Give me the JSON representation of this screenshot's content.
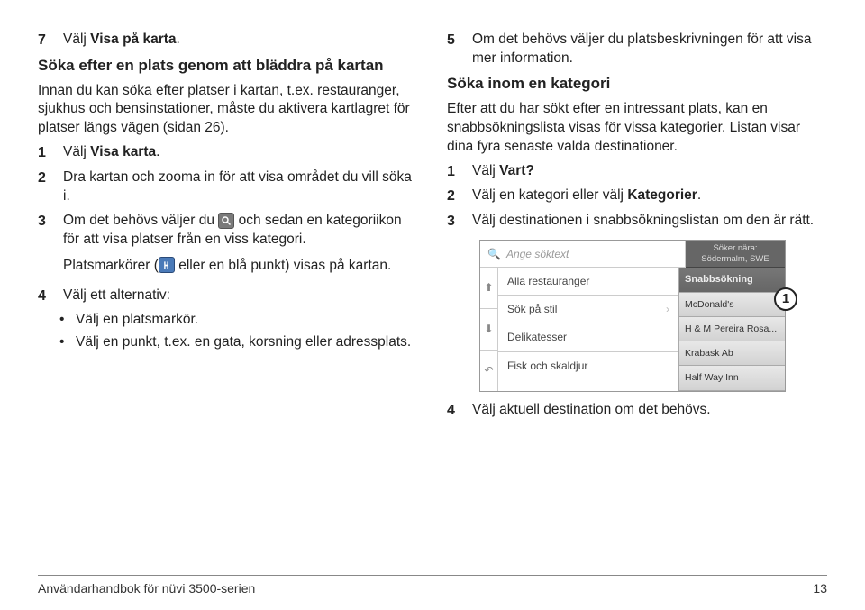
{
  "left": {
    "step7_num": "7",
    "step7": "Välj ",
    "step7_bold": "Visa på karta",
    "step7_end": ".",
    "heading": "Söka efter en plats genom att bläddra på kartan",
    "intro": "Innan du kan söka efter platser i kartan, t.ex. restauranger, sjukhus och bensinstationer, måste du aktivera kartlagret för platser längs vägen (sidan 26).",
    "s1_num": "1",
    "s1_a": "Välj ",
    "s1_b": "Visa karta",
    "s1_c": ".",
    "s2_num": "2",
    "s2": "Dra kartan och zooma in för att visa området du vill söka i.",
    "s3_num": "3",
    "s3_a": "Om det behövs väljer du ",
    "s3_b": " och sedan en kategoriikon för att visa platser från en viss kategori.",
    "markers_a": "Platsmarkörer (",
    "markers_b": " eller en blå punkt) visas på kartan.",
    "s4_num": "4",
    "s4": "Välj ett alternativ:",
    "s4_b1": "Välj en platsmarkör.",
    "s4_b2": "Välj en punkt, t.ex. en gata, korsning eller adressplats."
  },
  "right": {
    "s5_num": "5",
    "s5": "Om det behövs väljer du platsbeskrivningen för att visa mer information.",
    "heading": "Söka inom en kategori",
    "intro": "Efter att du har sökt efter en intressant plats, kan en snabbsökningslista visas för vissa kategorier. Listan visar dina fyra senaste valda destinationer.",
    "s1_num": "1",
    "s1_a": "Välj ",
    "s1_b": "Vart?",
    "s2_num": "2",
    "s2_a": "Välj en kategori eller välj ",
    "s2_b": "Kategorier",
    "s2_c": ".",
    "s3_num": "3",
    "s3": "Välj destinationen i snabbsökningslistan om den är rätt.",
    "s4_num": "4",
    "s4": "Välj aktuell destination om det behövs."
  },
  "device": {
    "search_placeholder": "Ange söktext",
    "near_label": "Söker nära:",
    "near_value": "Södermalm, SWE",
    "list": [
      "Alla restauranger",
      "Sök på stil",
      "Delikatesser",
      "Fisk och skaldjur"
    ],
    "right_head": "Snabbsökning",
    "right_items": [
      "McDonald's",
      "H & M Pereira Rosa...",
      "Krabask Ab",
      "Half Way Inn"
    ],
    "callout": "1"
  },
  "footer": {
    "left": "Användarhandbok för nüvi 3500-serien",
    "right": "13"
  }
}
